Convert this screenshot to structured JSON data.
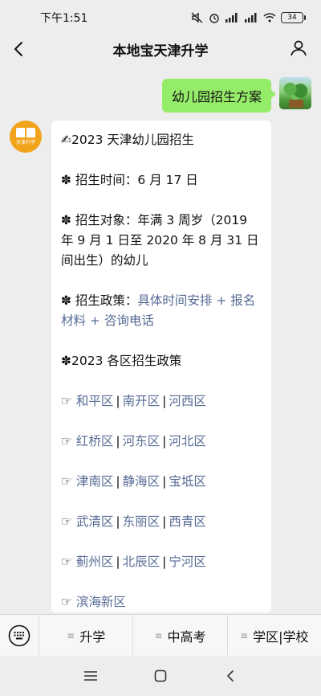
{
  "status": {
    "time": "下午1:51",
    "battery": "34"
  },
  "header": {
    "title": "本地宝天津升学"
  },
  "sent": {
    "text": "幼儿园招生方案"
  },
  "received": {
    "avatar_text": "天津升学",
    "line_title": "✍2023 天津幼儿园招生",
    "time_label": "✽ 招生时间：6 月 17 日",
    "target_label": "✽ 招生对象：年满 3 周岁（2019 年 9 月 1 日至 2020 年 8 月 31 日间出生）的幼儿",
    "policy_prefix": "✽ 招生政策：",
    "policy_links": "具体时间安排 + 报名材料 + 咨询电话",
    "district_title": "✽2023 各区招生政策",
    "district_rows": [
      [
        "和平区",
        "南开区",
        "河西区"
      ],
      [
        "红桥区",
        "河东区",
        "河北区"
      ],
      [
        "津南区",
        "静海区",
        "宝坻区"
      ],
      [
        "武清区",
        "东丽区",
        "西青区"
      ],
      [
        "蓟州区",
        "北辰区",
        "宁河区"
      ],
      [
        "滨海新区"
      ]
    ],
    "pointer": "☞"
  },
  "menu": {
    "items": [
      "升学",
      "中高考",
      "学区|学校"
    ]
  },
  "icons": {
    "back": "chevron-left-icon",
    "profile": "person-icon",
    "keyboard": "keyboard-icon"
  },
  "colors": {
    "sent_bubble": "#95ec69",
    "link": "#576b95",
    "background": "#ededed"
  }
}
